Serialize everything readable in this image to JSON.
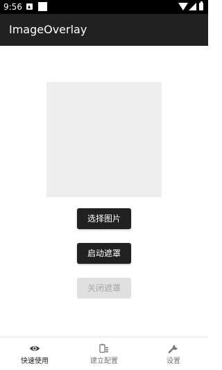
{
  "status_bar": {
    "time": "9:56"
  },
  "app_bar": {
    "title": "ImageOverlay"
  },
  "main": {
    "buttons": {
      "select_image": "选择图片",
      "start_overlay": "启动遮罩",
      "stop_overlay": "关闭遮罩"
    },
    "stop_overlay_enabled": false
  },
  "bottom_nav": {
    "items": [
      {
        "label": "快速使用",
        "icon": "eye-icon",
        "active": true
      },
      {
        "label": "建立配置",
        "icon": "clipboard-list-icon",
        "active": false
      },
      {
        "label": "设置",
        "icon": "wrench-icon",
        "active": false
      }
    ]
  },
  "colors": {
    "app_bar": "#212121",
    "status_bar": "#000000",
    "button_dark": "#212121",
    "button_disabled": "#e0e0e0",
    "preview_placeholder": "#eeeeee"
  }
}
